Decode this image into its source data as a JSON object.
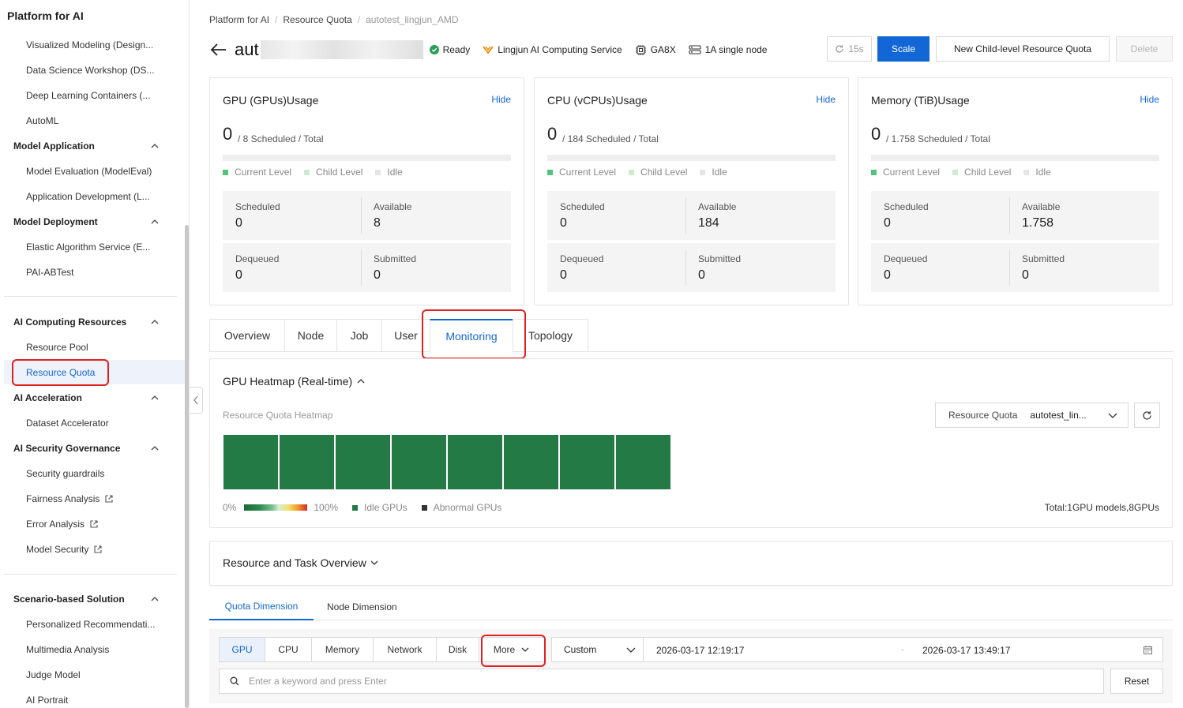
{
  "sidebar": {
    "title": "Platform for AI",
    "items_top": [
      "Visualized Modeling (Design...",
      "Data Science Workshop (DS...",
      "Deep Learning Containers (...",
      "AutoML"
    ],
    "group_model_application": "Model Application",
    "model_application_items": [
      "Model Evaluation (ModelEval)",
      "Application Development (L..."
    ],
    "group_model_deployment": "Model Deployment",
    "model_deployment_items": [
      "Elastic Algorithm Service (E...",
      "PAI-ABTest"
    ],
    "group_ai_computing": "AI Computing Resources",
    "ai_computing_items": [
      "Resource Pool",
      "Resource Quota"
    ],
    "group_ai_acceleration": "AI Acceleration",
    "ai_acceleration_items": [
      "Dataset Accelerator"
    ],
    "group_ai_security": "AI Security Governance",
    "ai_security_items": [
      "Security guardrails",
      "Fairness Analysis",
      "Error Analysis",
      "Model Security"
    ],
    "group_scenario": "Scenario-based Solution",
    "scenario_items": [
      "Personalized Recommendati...",
      "Multimedia Analysis",
      "Judge Model",
      "AI Portrait"
    ]
  },
  "breadcrumb": [
    "Platform for AI",
    "Resource Quota",
    "autotest_lingjun_AMD"
  ],
  "header": {
    "name_visible": "aut",
    "status": "Ready",
    "service": "Lingjun AI Computing Service",
    "gpu_model": "GA8X",
    "node_type": "1A single node",
    "refresh_label": "15s",
    "scale_label": "Scale",
    "new_child_label": "New Child-level Resource Quota",
    "delete_label": "Delete"
  },
  "cards": [
    {
      "title": "GPU (GPUs)Usage",
      "hide": "Hide",
      "used": "0",
      "summary": "/ 8 Scheduled / Total",
      "legend": [
        "Current Level",
        "Child Level",
        "Idle"
      ],
      "scheduled_label": "Scheduled",
      "scheduled": "0",
      "available_label": "Available",
      "available": "8",
      "dequeued_label": "Dequeued",
      "dequeued": "0",
      "submitted_label": "Submitted",
      "submitted": "0"
    },
    {
      "title": "CPU (vCPUs)Usage",
      "hide": "Hide",
      "used": "0",
      "summary": "/ 184 Scheduled / Total",
      "legend": [
        "Current Level",
        "Child Level",
        "Idle"
      ],
      "scheduled_label": "Scheduled",
      "scheduled": "0",
      "available_label": "Available",
      "available": "184",
      "dequeued_label": "Dequeued",
      "dequeued": "0",
      "submitted_label": "Submitted",
      "submitted": "0"
    },
    {
      "title": "Memory (TiB)Usage",
      "hide": "Hide",
      "used": "0",
      "summary": "/ 1.758 Scheduled / Total",
      "legend": [
        "Current Level",
        "Child Level",
        "Idle"
      ],
      "scheduled_label": "Scheduled",
      "scheduled": "0",
      "available_label": "Available",
      "available": "1.758",
      "dequeued_label": "Dequeued",
      "dequeued": "0",
      "submitted_label": "Submitted",
      "submitted": "0"
    }
  ],
  "tabs": [
    "Overview",
    "Node",
    "Job",
    "User",
    "Monitoring",
    "Topology"
  ],
  "heatmap": {
    "title": "GPU Heatmap (Real-time)",
    "subtitle": "Resource Quota Heatmap",
    "select_key": "Resource Quota",
    "select_value": "autotest_lin...",
    "legend_min": "0%",
    "legend_max": "100%",
    "legend_idle": "Idle GPUs",
    "legend_abnormal": "Abnormal GPUs",
    "total": "Total:1GPU models,8GPUs",
    "cell_count": 8
  },
  "overview": {
    "title": "Resource and Task Overview"
  },
  "subtabs": [
    "Quota Dimension",
    "Node Dimension"
  ],
  "filter": {
    "segments": [
      "GPU",
      "CPU",
      "Memory",
      "Network",
      "Disk",
      "More"
    ],
    "range_type": "Custom",
    "start": "2026-03-17 12:19:17",
    "end": "2026-03-17 13:49:17",
    "search_placeholder": "Enter a keyword and press Enter",
    "reset_label": "Reset"
  },
  "colors": {
    "accent": "#1366d6",
    "ready": "#2aa052",
    "heat_cell": "#237a45",
    "highlight": "#e02020",
    "legend_current": "#52c47a",
    "legend_child": "#cdeccf",
    "legend_idle": "#e6e6e6"
  }
}
